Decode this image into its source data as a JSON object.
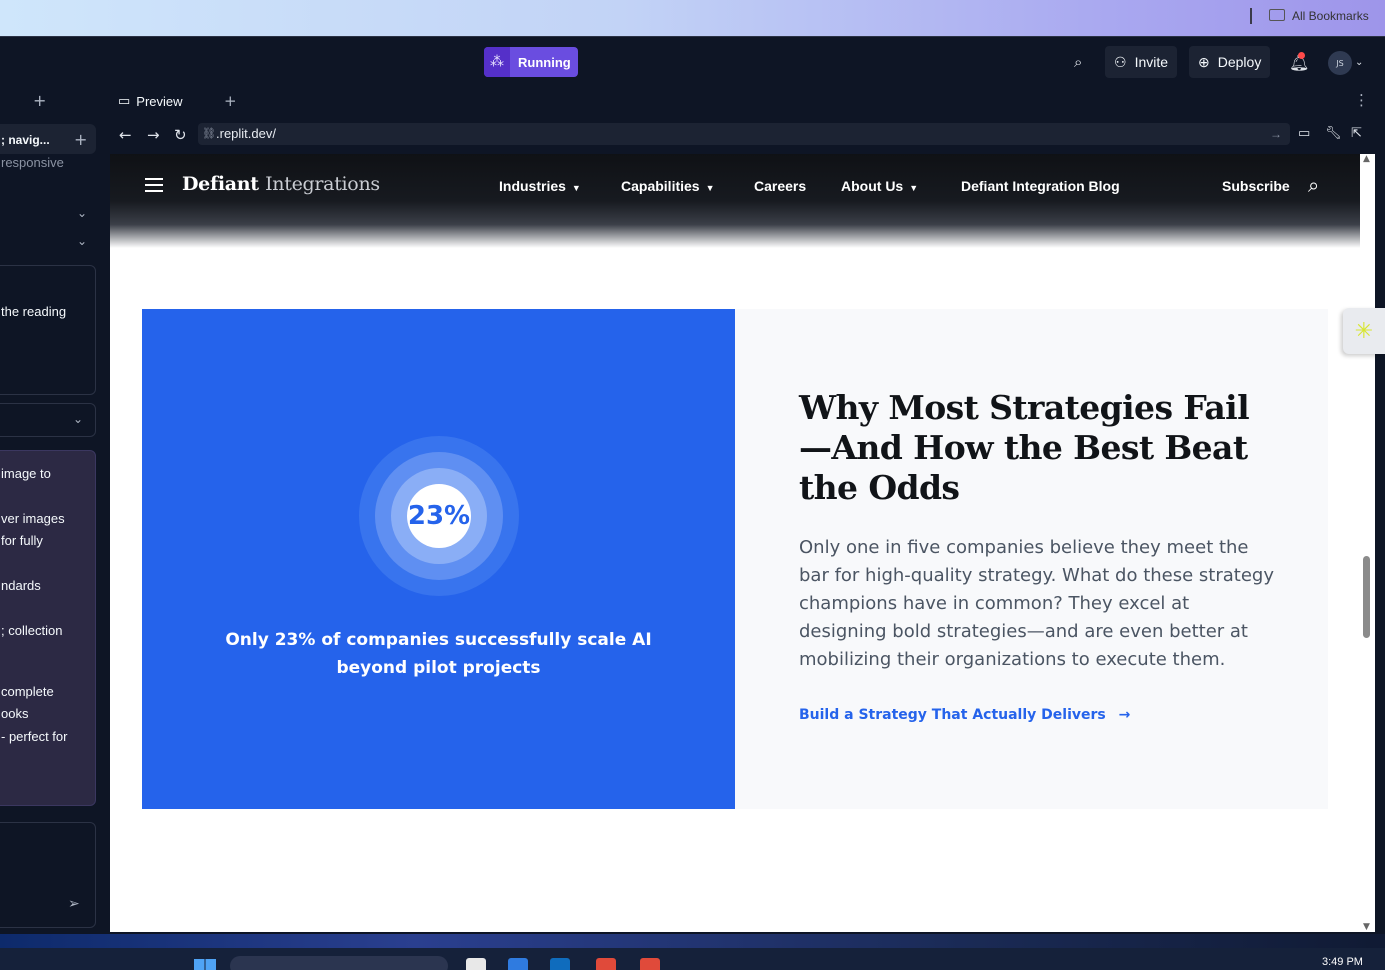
{
  "browser": {
    "bookmarks_label": "All Bookmarks"
  },
  "topbar": {
    "status_label": "Running",
    "invite_label": "Invite",
    "deploy_label": "Deploy",
    "avatar_initials": "JS"
  },
  "left_panel": {
    "snippets": [
      "; navig...",
      "responsive",
      "the reading",
      "image to",
      "ver images",
      "for fully",
      "ndards",
      "; collection",
      "complete",
      "ooks",
      "- perfect for"
    ]
  },
  "preview": {
    "tab_label": "Preview",
    "url": ".replit.dev/"
  },
  "site": {
    "logo_main": "Defiant",
    "logo_secondary": "Integrations",
    "nav": {
      "industries": "Industries",
      "capabilities": "Capabilities",
      "careers": "Careers",
      "about": "About Us",
      "blog": "Defiant Integration Blog",
      "subscribe": "Subscribe"
    },
    "stat": {
      "value": "23%",
      "caption": "Only 23% of companies successfully scale AI beyond pilot projects"
    },
    "heading": "Why Most Strategies Fail—And How the Best Beat the Odds",
    "body": "Only one in five companies believe they meet the bar for high-quality strategy. What do these strategy champions have in common? They excel at designing bold strategies—and are even better at mobilizing their organizations to execute them.",
    "cta": "Build a Strategy That Actually Delivers"
  },
  "taskbar": {
    "time": "3:49 PM"
  },
  "colors": {
    "brand_blue": "#2563eb",
    "running_purple": "#6a4de0"
  }
}
